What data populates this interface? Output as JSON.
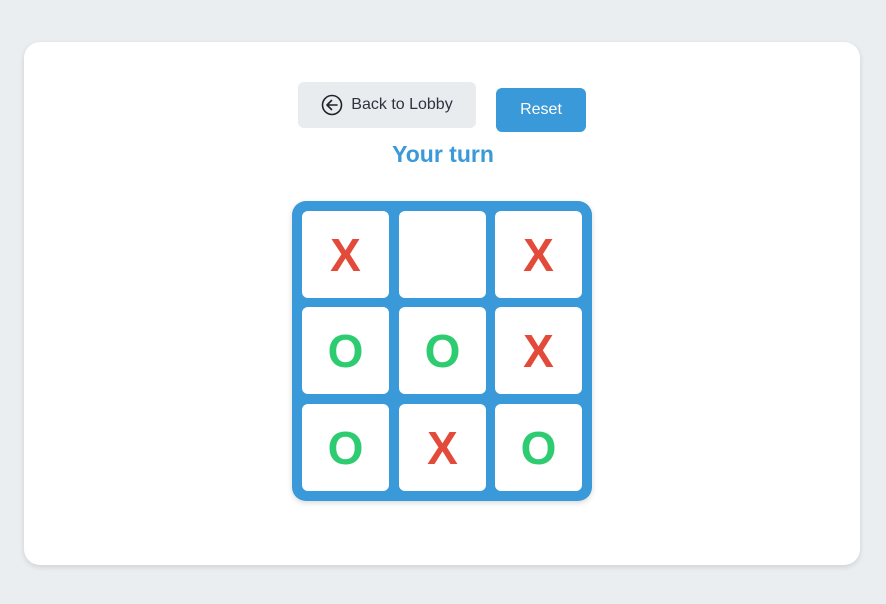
{
  "header": {
    "back_label": "Back to Lobby",
    "back_icon": "arrow-left-circle-icon",
    "reset_label": "Reset"
  },
  "status": {
    "text": "Your turn"
  },
  "board": {
    "cells": [
      "X",
      "",
      "X",
      "O",
      "O",
      "X",
      "O",
      "X",
      "O"
    ]
  },
  "colors": {
    "accent": "#3a99d8",
    "x_mark": "#e44a3a",
    "o_mark": "#2ecc71",
    "background": "#ebeef0"
  }
}
